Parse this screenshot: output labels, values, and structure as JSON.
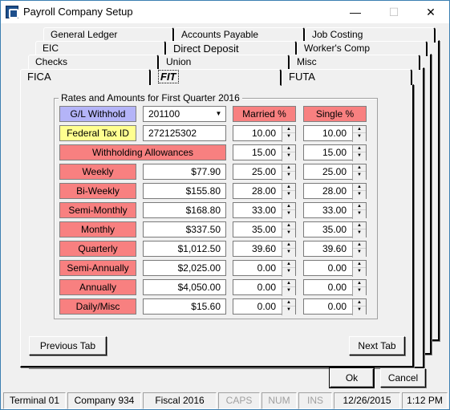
{
  "window": {
    "title": "Payroll Company Setup",
    "minimize": "—",
    "maximize": "☐",
    "close": "✕"
  },
  "tabs": {
    "row4": [
      "General Ledger",
      "Accounts Payable",
      "Job Costing"
    ],
    "row3": [
      "EIC",
      "Direct Deposit",
      "Worker's Comp"
    ],
    "row2": [
      "Checks",
      "Union",
      "Misc"
    ],
    "row1": [
      "FICA",
      "FIT",
      "FUTA"
    ],
    "active": "FIT"
  },
  "group": {
    "legend": "Rates and Amounts for First Quarter 2016",
    "gl_withhold_label": "G/L Withhold",
    "gl_withhold_value": "201100",
    "federal_tax_id_label": "Federal Tax ID",
    "federal_tax_id_value": "272125302",
    "withholding_allowances_label": "Withholding Allowances",
    "married_header": "Married %",
    "single_header": "Single %",
    "pay_periods": [
      {
        "label": "Weekly",
        "amount": "$77.90"
      },
      {
        "label": "Bi-Weekly",
        "amount": "$155.80"
      },
      {
        "label": "Semi-Monthly",
        "amount": "$168.80"
      },
      {
        "label": "Monthly",
        "amount": "$337.50"
      },
      {
        "label": "Quarterly",
        "amount": "$1,012.50"
      },
      {
        "label": "Semi-Annually",
        "amount": "$2,025.00"
      },
      {
        "label": "Annually",
        "amount": "$4,050.00"
      },
      {
        "label": "Daily/Misc",
        "amount": "$15.60"
      }
    ],
    "married_rates": [
      "10.00",
      "15.00",
      "25.00",
      "28.00",
      "33.00",
      "35.00",
      "39.60",
      "0.00",
      "0.00",
      "0.00"
    ],
    "single_rates": [
      "10.00",
      "15.00",
      "25.00",
      "28.00",
      "33.00",
      "35.00",
      "39.60",
      "0.00",
      "0.00",
      "0.00"
    ]
  },
  "buttons": {
    "previous_tab": "Previous Tab",
    "next_tab": "Next Tab",
    "ok": "Ok",
    "cancel": "Cancel"
  },
  "statusbar": [
    "Terminal 01",
    "Company 934",
    "Fiscal 2016",
    "CAPS",
    "NUM",
    "INS",
    "12/26/2015",
    "1:12 PM"
  ],
  "colors": {
    "label_red": "#f88080",
    "label_blue": "#b4b4f8",
    "label_yellow": "#ffff90",
    "window_bg": "#f0f0f0"
  }
}
